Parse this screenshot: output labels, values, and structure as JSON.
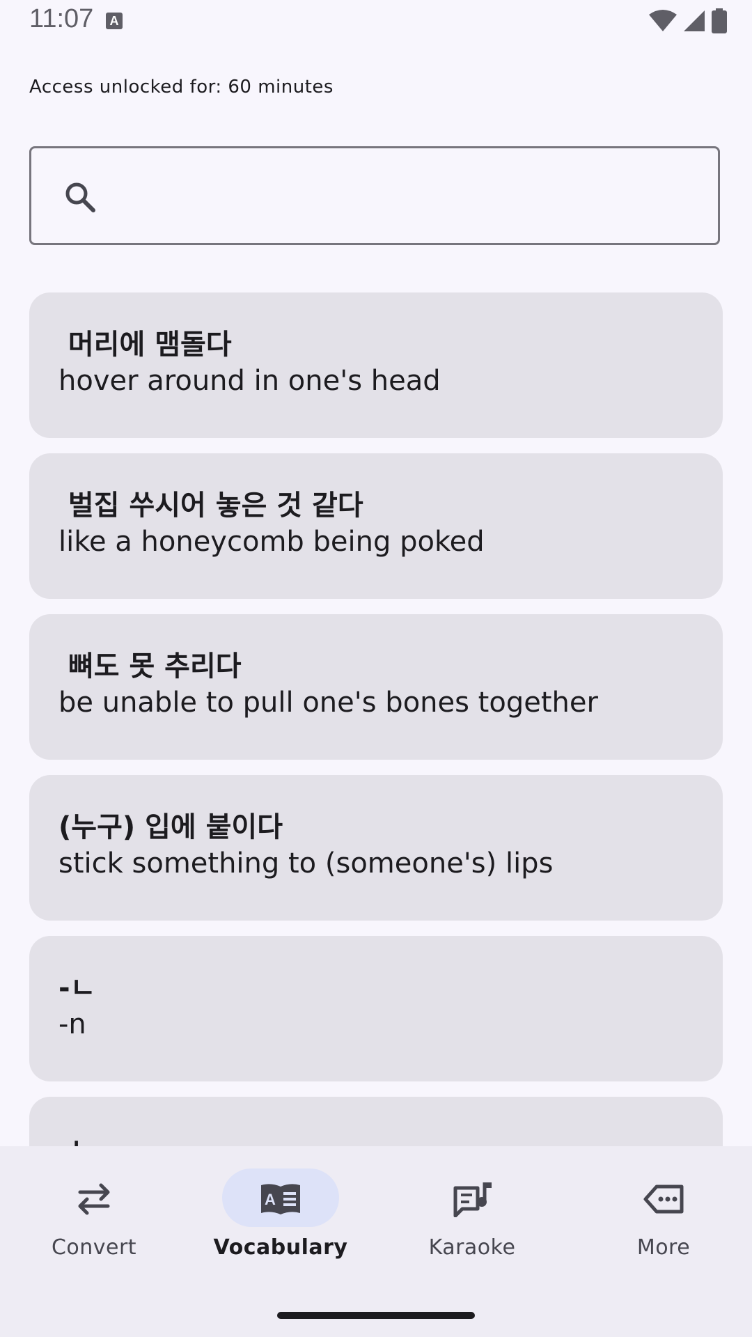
{
  "status_bar": {
    "time": "11:07",
    "notification_icon": "a-badge-icon"
  },
  "access_text": "Access unlocked for: 60 minutes",
  "search": {
    "placeholder": "",
    "value": ""
  },
  "vocab_items": [
    {
      "korean": " 머리에 맴돌다",
      "english": "hover around in one's head"
    },
    {
      "korean": " 벌집 쑤시어 놓은 것 같다",
      "english": "like a honeycomb being poked"
    },
    {
      "korean": " 뼈도 못 추리다",
      "english": "be unable to pull one's bones together"
    },
    {
      "korean": "(누구) 입에 붙이다",
      "english": "stick something to (someone's) lips"
    },
    {
      "korean": "-ㄴ",
      "english": "-n"
    },
    {
      "korean": "-ㄴ",
      "english": ""
    }
  ],
  "bottom_nav": [
    {
      "label": "Convert",
      "icon": "swap-icon",
      "active": false
    },
    {
      "label": "Vocabulary",
      "icon": "book-icon",
      "active": true
    },
    {
      "label": "Karaoke",
      "icon": "lyrics-icon",
      "active": false
    },
    {
      "label": "More",
      "icon": "label-icon",
      "active": false
    }
  ],
  "colors": {
    "background": "#f8f6fd",
    "card": "#e3e1e8",
    "nav_bg": "#eeecf4",
    "active_pill": "#dde2f8"
  }
}
